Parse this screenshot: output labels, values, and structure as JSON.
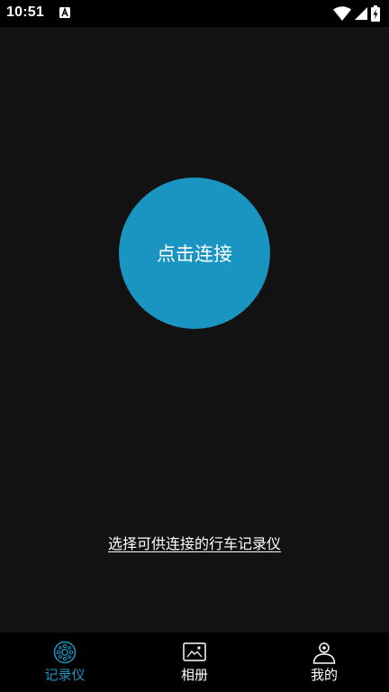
{
  "status_bar": {
    "time": "10:51",
    "icons": [
      "a-notification-icon",
      "wifi-icon",
      "signal-icon",
      "battery-charging-icon"
    ]
  },
  "main": {
    "connect_button_label": "点击连接",
    "select_link_label": "选择可供连接的行车记录仪"
  },
  "bottom_nav": {
    "items": [
      {
        "label": "记录仪",
        "icon": "dashcam-icon",
        "active": true
      },
      {
        "label": "相册",
        "icon": "album-icon",
        "active": false
      },
      {
        "label": "我的",
        "icon": "profile-icon",
        "active": false
      }
    ]
  },
  "colors": {
    "accent": "#1a95c2",
    "background": "#121212",
    "bar_background": "#000000",
    "text": "#ffffff"
  }
}
